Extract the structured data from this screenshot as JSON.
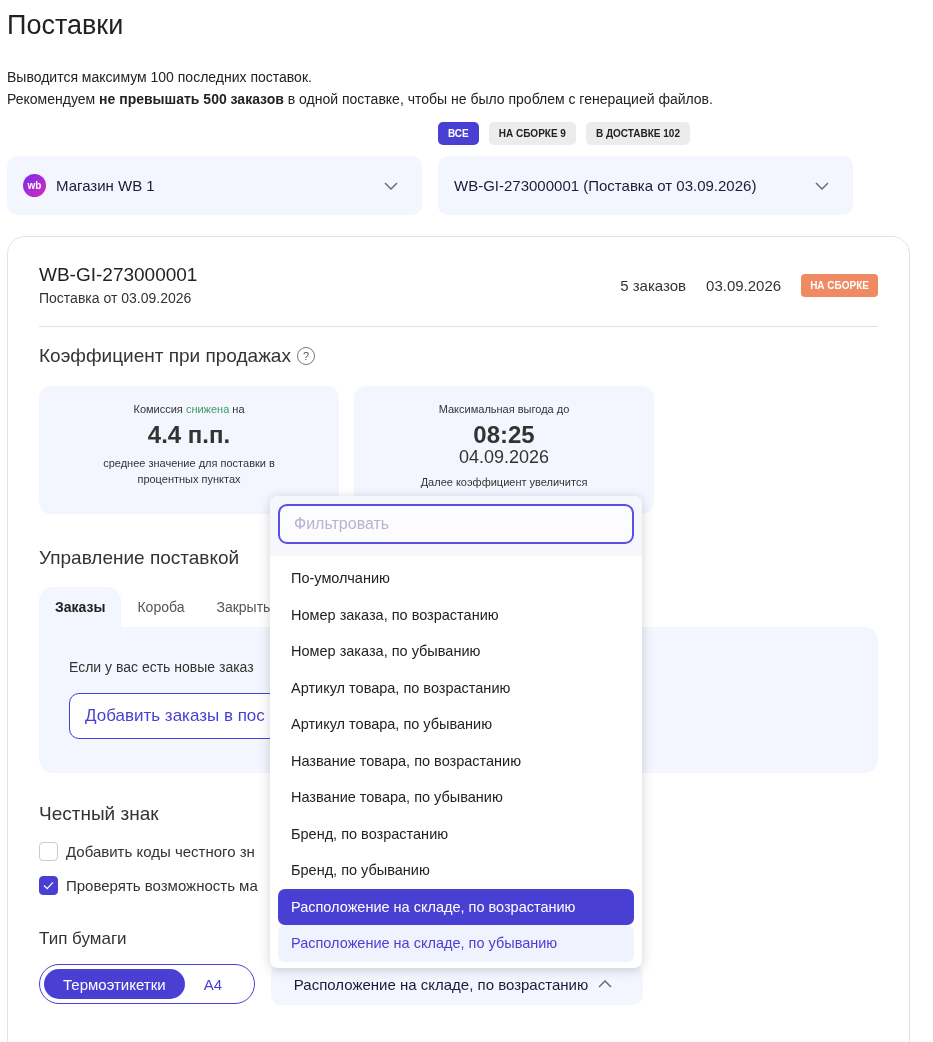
{
  "page": {
    "title": "Поставки",
    "notes": [
      "Выводится максимум 100 последних поставок.",
      "Рекомендуем **не превышать 500 заказов** в одной поставке, чтобы не было проблем с генерацией файлов."
    ]
  },
  "status_filters": [
    {
      "label": "ВСЕ",
      "selected": true
    },
    {
      "label": "НА СБОРКЕ 9",
      "selected": false
    },
    {
      "label": "В ДОСТАВКЕ 102",
      "selected": false
    }
  ],
  "store_select": {
    "logo": "wb",
    "value": "Магазин WB 1",
    "expanded": false
  },
  "supply_select": {
    "value": "WB-GI-273000001 (Поставка от 03.09.2026)",
    "expanded": false
  },
  "supply": {
    "id": "WB-GI-273000001",
    "subtitle": "Поставка от 03.09.2026",
    "orders": "5 заказов",
    "date": "03.09.2026",
    "status": "НА СБОРКЕ",
    "coefficient_title": "Коэффициент при продажах",
    "help": "?",
    "commission": {
      "before": "Комиссия ",
      "accent": "снижена",
      "after": " на",
      "value": "4.4 п.п.",
      "note": "среднее значение для поставки в процентных пунктах"
    },
    "benefit": {
      "label": "Максимальная выгода до",
      "time": "08:25",
      "date": "04.09.2026",
      "note": "Далее коэффициент увеличится"
    }
  },
  "management": {
    "title": "Управление поставкой",
    "tabs": [
      {
        "label": "Заказы",
        "selected": true
      },
      {
        "label": "Короба",
        "selected": false
      },
      {
        "label": "Закрыть",
        "selected": false
      }
    ],
    "text": "Если у вас есть новые заказ",
    "button": "Добавить заказы в пос"
  },
  "honest_sign": {
    "title": "Честный знак",
    "options": [
      {
        "label": "Добавить коды честного зн",
        "checked": false
      },
      {
        "label": "Проверять возможность ма",
        "checked": true
      }
    ]
  },
  "paper": {
    "title": "Тип бумаги",
    "options": [
      {
        "label": "Термоэтикетки",
        "selected": true
      },
      {
        "label": "A4",
        "selected": false
      }
    ]
  },
  "sort_select": {
    "value": "Расположение на складе, по возрастанию",
    "expanded": true
  },
  "sort_menu": {
    "placeholder": "Фильтровать",
    "options": [
      {
        "label": "По-умолчанию",
        "selected": false,
        "highlighted": false
      },
      {
        "label": "Номер заказа, по возрастанию",
        "selected": false,
        "highlighted": false
      },
      {
        "label": "Номер заказа, по убыванию",
        "selected": false,
        "highlighted": false
      },
      {
        "label": "Артикул товара, по возрастанию",
        "selected": false,
        "highlighted": false
      },
      {
        "label": "Артикул товара, по убыванию",
        "selected": false,
        "highlighted": false
      },
      {
        "label": "Название товара, по возрастанию",
        "selected": false,
        "highlighted": false
      },
      {
        "label": "Название товара, по убыванию",
        "selected": false,
        "highlighted": false
      },
      {
        "label": "Бренд, по возрастанию",
        "selected": false,
        "highlighted": false
      },
      {
        "label": "Бренд, по убыванию",
        "selected": false,
        "highlighted": false
      },
      {
        "label": "Расположение на складе, по возрастанию",
        "selected": true,
        "highlighted": false
      },
      {
        "label": "Расположение на складе, по убыванию",
        "selected": false,
        "highlighted": true
      }
    ]
  }
}
